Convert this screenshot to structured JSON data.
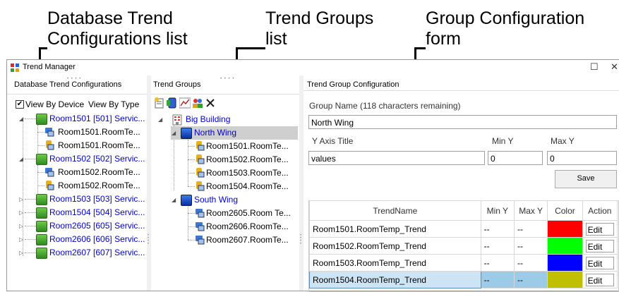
{
  "callouts": {
    "db_list": [
      "Database Trend",
      "Configurations list"
    ],
    "groups_list": [
      "Trend Groups",
      "list"
    ],
    "group_form": [
      "Group Configuration",
      "form"
    ]
  },
  "window": {
    "title": "Trend Manager",
    "maximize_glyph": "☐",
    "close_glyph": "✕"
  },
  "left_pane": {
    "header": "Database Trend Configurations",
    "view_by_device": "View By Device",
    "view_by_type": "View By Type",
    "view_by_device_checked": true,
    "tree": [
      {
        "label": "Room1501 [501] Servic...",
        "children": [
          "Room1501.RoomTe...",
          "Room1501.RoomTe..."
        ]
      },
      {
        "label": "Room1502 [502] Servic...",
        "children": [
          "Room1502.RoomTe...",
          "Room1502.RoomTe..."
        ]
      },
      {
        "label": "Room1503 [503] Servic...",
        "children": []
      },
      {
        "label": "Room1504 [504] Servic...",
        "children": []
      },
      {
        "label": "Room2605 [605] Servic...",
        "children": []
      },
      {
        "label": "Room2606 [606] Servic...",
        "children": []
      },
      {
        "label": "Room2607 [607] Servic...",
        "children": []
      }
    ]
  },
  "middle_pane": {
    "header": "Trend Groups",
    "root": "Big Building",
    "groups": [
      {
        "name": "North Wing",
        "selected": true,
        "trends": [
          "Room1501.RoomTe...",
          "Room1502.RoomTe...",
          "Room1503.RoomTe...",
          "Room1504.RoomTe..."
        ]
      },
      {
        "name": "South Wing",
        "selected": false,
        "trends": [
          "Room2605.Room Te...",
          "Room2606.RoomTe...",
          "Room2607.RoomTe..."
        ]
      }
    ]
  },
  "right_pane": {
    "header": "Trend Group Configuration",
    "group_name_label": "Group Name (118 characters remaining)",
    "group_name_value": "North Wing",
    "y_axis_title_label": "Y Axis Title",
    "min_y_label": "Min Y",
    "max_y_label": "Max Y",
    "y_axis_title_value": "values",
    "min_y_value": "0",
    "max_y_value": "0",
    "save_label": "Save",
    "table": {
      "headers": [
        "TrendName",
        "Min Y",
        "Max Y",
        "Color",
        "Action"
      ],
      "rows": [
        {
          "name": "Room1501.RoomTemp_Trend",
          "min": "--",
          "max": "--",
          "color": "#ff0000",
          "action": "Edit",
          "selected": false
        },
        {
          "name": "Room1502.RoomTemp_Trend",
          "min": "--",
          "max": "--",
          "color": "#00ff00",
          "action": "Edit",
          "selected": false
        },
        {
          "name": "Room1503.RoomTemp_Trend",
          "min": "--",
          "max": "--",
          "color": "#0000ff",
          "action": "Edit",
          "selected": false
        },
        {
          "name": "Room1504.RoomTemp_Trend",
          "min": "--",
          "max": "--",
          "color": "#c0c000",
          "action": "Edit",
          "selected": true
        }
      ]
    }
  }
}
